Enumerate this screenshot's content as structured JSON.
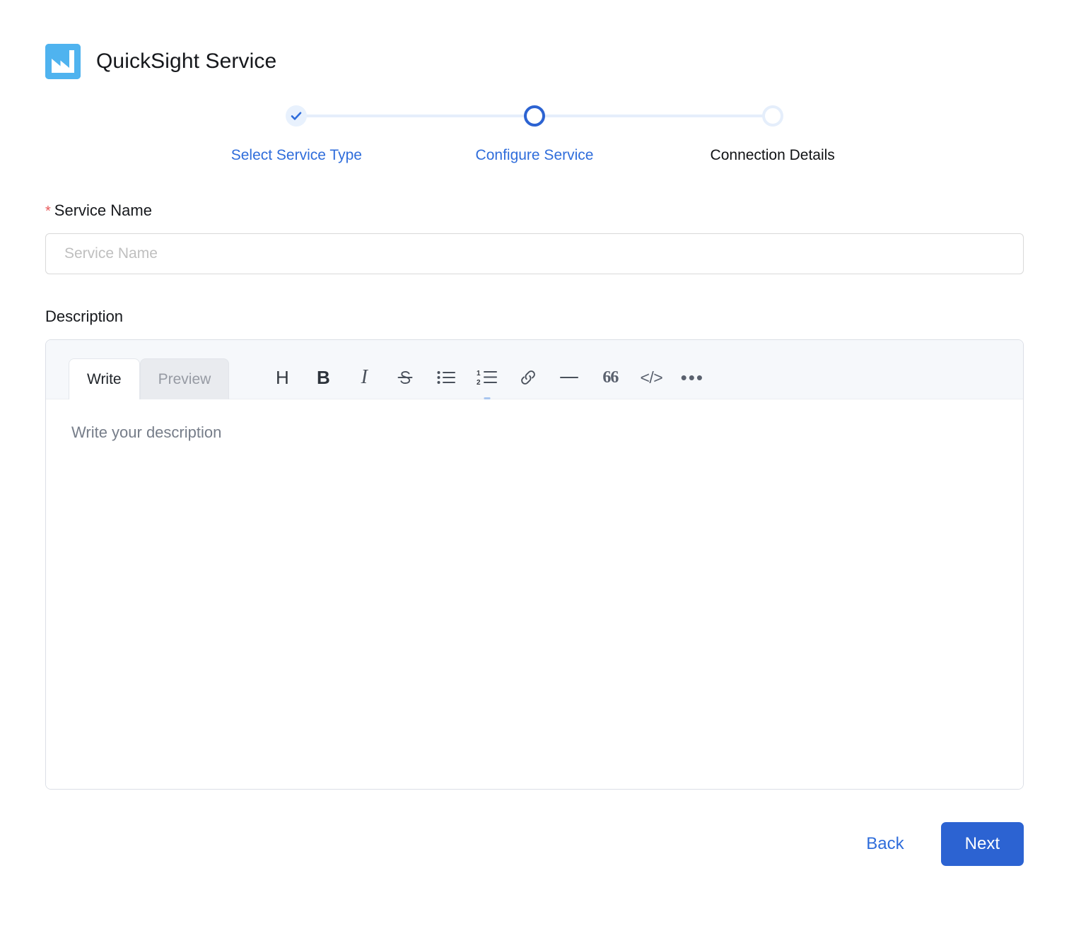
{
  "header": {
    "title": "QuickSight Service",
    "logo_icon": "quicksight-logo-icon",
    "logo_color": "#4fb3ef"
  },
  "stepper": {
    "accent_color": "#2c63d2",
    "connector_color": "#e5eefb",
    "steps": [
      {
        "label": "Select Service Type",
        "state": "done",
        "icon": "check-icon"
      },
      {
        "label": "Configure Service",
        "state": "active",
        "icon": "circle-icon"
      },
      {
        "label": "Connection Details",
        "state": "todo",
        "icon": "circle-icon"
      }
    ]
  },
  "form": {
    "service_name": {
      "label": "Service Name",
      "required_marker": "*",
      "required_color": "#e8595a",
      "value": "",
      "placeholder": "Service Name"
    },
    "description": {
      "label": "Description",
      "value": "",
      "placeholder": "Write your description"
    }
  },
  "editor": {
    "tabs": [
      {
        "label": "Write",
        "active": true
      },
      {
        "label": "Preview",
        "active": false
      }
    ],
    "tools": [
      {
        "name": "heading-icon",
        "glyph": "H",
        "title": "Heading"
      },
      {
        "name": "bold-icon",
        "glyph": "B",
        "title": "Bold"
      },
      {
        "name": "italic-icon",
        "glyph": "I",
        "title": "Italic"
      },
      {
        "name": "strikethrough-icon",
        "glyph": "S",
        "title": "Strikethrough"
      },
      {
        "name": "bulleted-list-icon",
        "glyph": "",
        "title": "Bulleted list"
      },
      {
        "name": "numbered-list-icon",
        "glyph": "",
        "title": "Numbered list"
      },
      {
        "name": "link-icon",
        "glyph": "",
        "title": "Link"
      },
      {
        "name": "horizontal-rule-icon",
        "glyph": "",
        "title": "Horizontal rule"
      },
      {
        "name": "quote-icon",
        "glyph": "66",
        "title": "Quote"
      },
      {
        "name": "code-icon",
        "glyph": "</>",
        "title": "Code"
      },
      {
        "name": "more-options-icon",
        "glyph": "•••",
        "title": "More"
      }
    ]
  },
  "footer": {
    "back_label": "Back",
    "next_label": "Next",
    "next_color": "#2c63d2",
    "back_color": "#2f6ddb"
  }
}
